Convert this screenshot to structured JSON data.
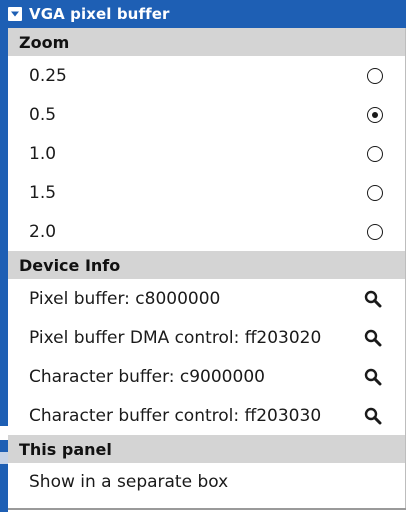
{
  "window": {
    "title": "VGA pixel buffer"
  },
  "menu": {
    "zoom": {
      "header": "Zoom",
      "options": [
        {
          "label": "0.25",
          "selected": false
        },
        {
          "label": "0.5",
          "selected": true
        },
        {
          "label": "1.0",
          "selected": false
        },
        {
          "label": "1.5",
          "selected": false
        },
        {
          "label": "2.0",
          "selected": false
        }
      ]
    },
    "device_info": {
      "header": "Device Info",
      "items": [
        {
          "label": "Pixel buffer: c8000000",
          "icon": "search-icon"
        },
        {
          "label": "Pixel buffer DMA control: ff203020",
          "icon": "search-icon"
        },
        {
          "label": "Character buffer: c9000000",
          "icon": "search-icon"
        },
        {
          "label": "Character buffer control: ff203030",
          "icon": "search-icon"
        }
      ]
    },
    "this_panel": {
      "header": "This panel",
      "items": [
        {
          "label": "Show in a separate box"
        }
      ]
    }
  },
  "colors": {
    "title_bar": "#1e5fb4",
    "section_header": "#d4d4d4",
    "text": "#1a1a1a"
  }
}
